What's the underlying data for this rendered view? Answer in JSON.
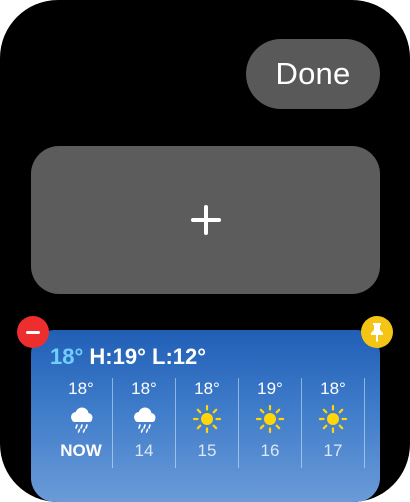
{
  "header": {
    "done_label": "Done"
  },
  "add_widget": {
    "icon": "plus-icon"
  },
  "weather": {
    "current_temp": "18°",
    "high_low": "H:19° L:12°",
    "forecast": [
      {
        "temp": "18°",
        "icon": "rain-cloud-icon",
        "label": "NOW"
      },
      {
        "temp": "18°",
        "icon": "rain-cloud-icon",
        "label": "14"
      },
      {
        "temp": "18°",
        "icon": "sun-icon",
        "label": "15"
      },
      {
        "temp": "19°",
        "icon": "sun-icon",
        "label": "16"
      },
      {
        "temp": "18°",
        "icon": "sun-icon",
        "label": "17"
      }
    ]
  },
  "badges": {
    "remove_icon": "minus-circle-icon",
    "pin_icon": "pin-icon"
  },
  "colors": {
    "remove_badge": "#ee2e2e",
    "pin_badge": "#f5c516",
    "current_temp": "#6fd0ff",
    "sun": "#ffd60a"
  }
}
